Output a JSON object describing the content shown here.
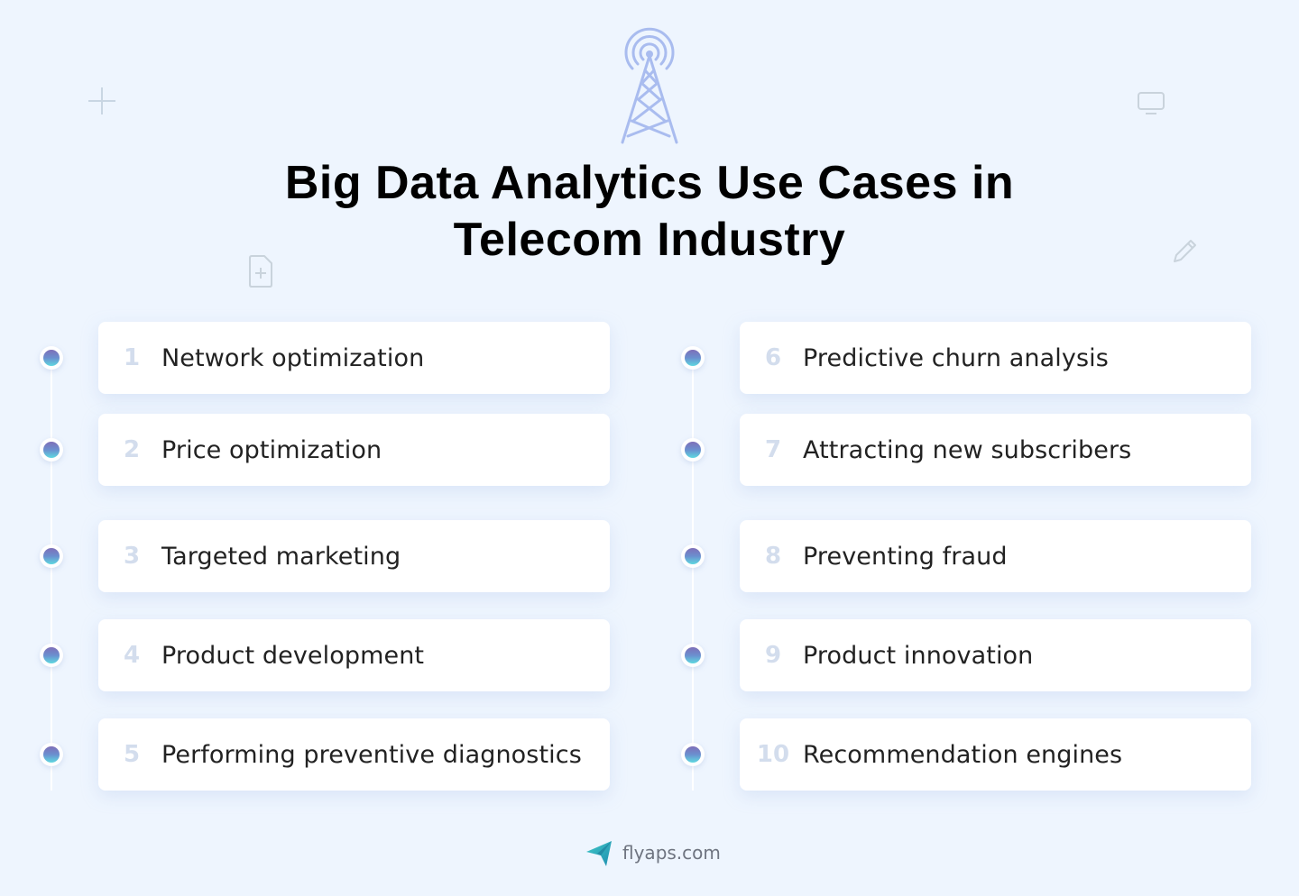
{
  "header": {
    "title_line1": "Big Data Analytics Use Cases in",
    "title_line2": "Telecom Industry",
    "icon": "radio-tower-icon"
  },
  "decorations": [
    "plus-icon",
    "monitor-icon",
    "file-add-icon",
    "pencil-icon"
  ],
  "colors": {
    "background": "#eef5fe",
    "card": "#ffffff",
    "number": "#d3dded",
    "tower": "#a9bcef",
    "dot_gradient_top": "#7e6fb8",
    "dot_gradient_bottom": "#5fd8e0",
    "logo": "#2bb3c0"
  },
  "left_column": [
    {
      "number": "1",
      "label": "Network optimization"
    },
    {
      "number": "2",
      "label": "Price optimization"
    },
    {
      "number": "3",
      "label": "Targeted marketing"
    },
    {
      "number": "4",
      "label": "Product development"
    },
    {
      "number": "5",
      "label": "Performing preventive diagnostics"
    }
  ],
  "right_column": [
    {
      "number": "6",
      "label": "Predictive churn analysis"
    },
    {
      "number": "7",
      "label": "Attracting new subscribers"
    },
    {
      "number": "8",
      "label": "Preventing fraud"
    },
    {
      "number": "9",
      "label": "Product innovation"
    },
    {
      "number": "10",
      "label": "Recommendation engines"
    }
  ],
  "footer": {
    "brand": "flyaps.com",
    "icon": "paper-plane-logo-icon"
  }
}
